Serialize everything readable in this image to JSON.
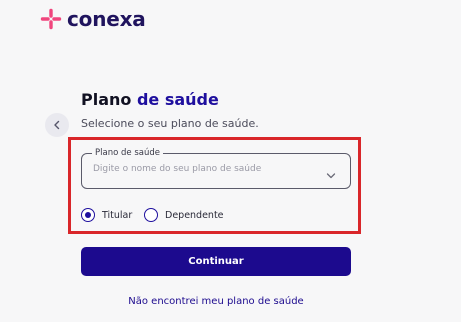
{
  "brand": {
    "name": "conexa",
    "logo_icon": "sparkle-cross-icon",
    "colors": {
      "primary": "#1c0a8e",
      "accent": "#f0457d",
      "highlight": "#d9262a"
    }
  },
  "back": {
    "icon": "chevron-left-icon"
  },
  "heading": {
    "title_part1": "Plano",
    "title_part2": "de saúde",
    "subtitle": "Selecione o seu plano de saúde."
  },
  "plan_field": {
    "label": "Plano de saúde",
    "placeholder": "Digite o nome do seu plano de saúde",
    "value": "",
    "icon": "chevron-down-icon"
  },
  "holder_type": {
    "options": [
      {
        "label": "Titular",
        "selected": true
      },
      {
        "label": "Dependente",
        "selected": false
      }
    ]
  },
  "actions": {
    "continue_label": "Continuar",
    "not_found_link": "Não encontrei meu plano de saúde"
  }
}
